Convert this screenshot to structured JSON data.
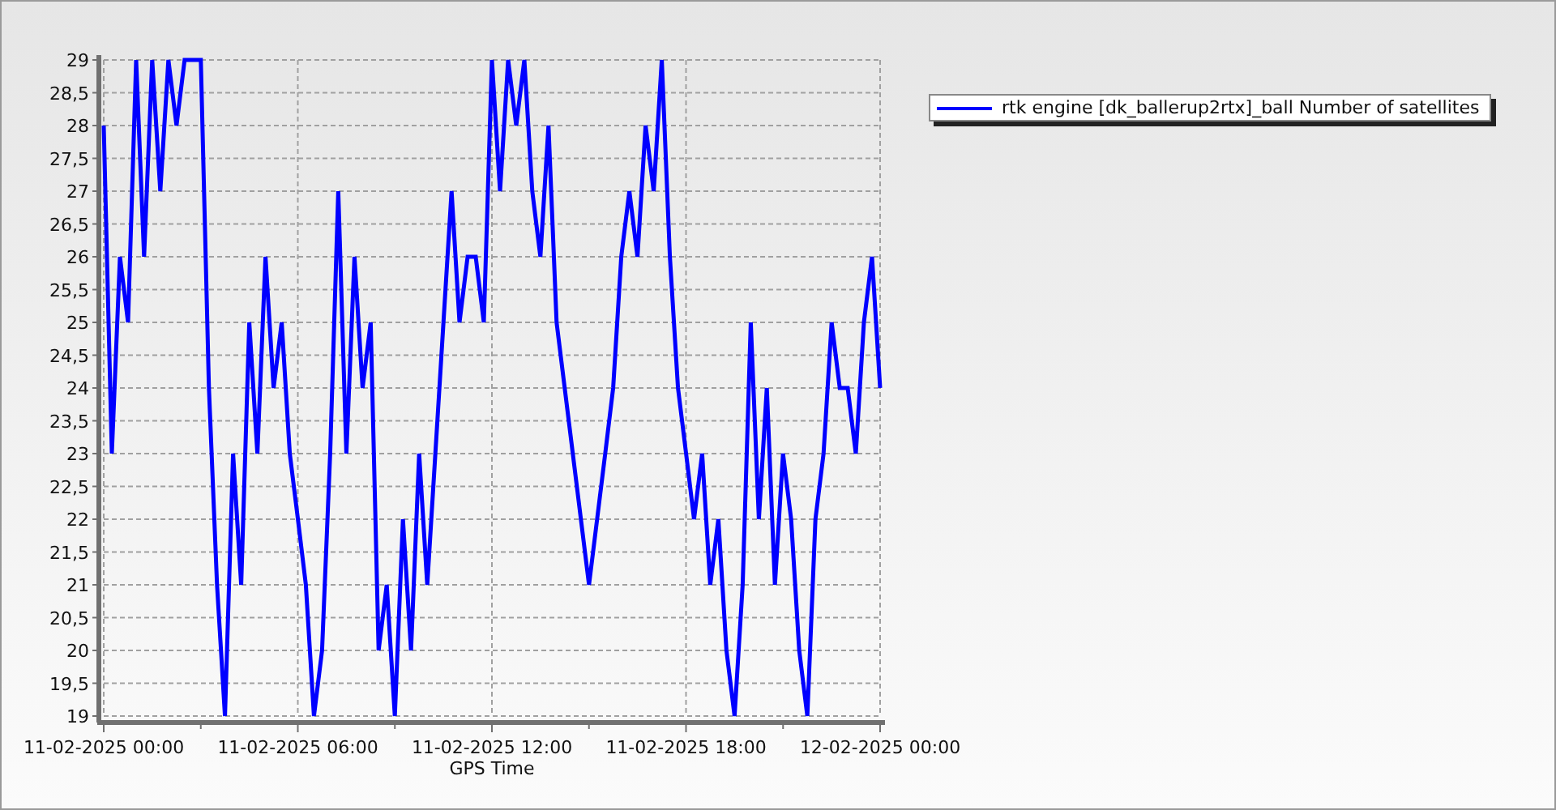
{
  "chart": {
    "chart_data": {
      "type": "line",
      "xlabel": "GPS Time",
      "categories": [
        "11-02-2025 00:00",
        null,
        null,
        null,
        null,
        null,
        null,
        null,
        null,
        null,
        null,
        null,
        null,
        null,
        null,
        null,
        null,
        null,
        null,
        null,
        null,
        null,
        null,
        null,
        "11-02-2025 06:00",
        null,
        null,
        null,
        null,
        null,
        null,
        null,
        null,
        null,
        null,
        null,
        null,
        null,
        null,
        null,
        null,
        null,
        null,
        null,
        null,
        null,
        null,
        null,
        "11-02-2025 12:00",
        null,
        null,
        null,
        null,
        null,
        null,
        null,
        null,
        null,
        null,
        null,
        null,
        null,
        null,
        null,
        null,
        null,
        null,
        null,
        null,
        null,
        null,
        null,
        "11-02-2025 18:00",
        null,
        null,
        null,
        null,
        null,
        null,
        null,
        null,
        null,
        null,
        null,
        null,
        null,
        null,
        null,
        null,
        null,
        null,
        null,
        null,
        null,
        null,
        null,
        "12-02-2025 00:00"
      ],
      "series": [
        {
          "name": "rtk engine [dk_ballerup2rtx]_ball Number of satellites",
          "color": "#0000ff",
          "values": [
            28,
            23,
            26,
            25,
            29,
            26,
            29,
            27,
            29,
            28,
            29,
            29,
            29,
            24,
            21,
            19,
            23,
            21,
            25,
            23,
            26,
            24,
            25,
            23,
            22,
            21,
            19,
            20,
            23,
            27,
            23,
            26,
            24,
            25,
            20,
            21,
            19,
            22,
            20,
            23,
            21,
            23,
            25,
            27,
            25,
            26,
            26,
            25,
            29,
            27,
            29,
            28,
            29,
            27,
            26,
            28,
            25,
            24,
            23,
            22,
            21,
            22,
            23,
            24,
            26,
            27,
            26,
            28,
            27,
            29,
            26,
            24,
            23,
            22,
            23,
            21,
            22,
            20,
            19,
            21,
            25,
            22,
            24,
            21,
            23,
            22,
            20,
            19,
            22,
            23,
            25,
            24,
            24,
            23,
            25,
            26,
            24
          ]
        }
      ],
      "ylim": [
        19,
        29
      ],
      "grid": true,
      "yticks": [
        19,
        {
          "value": 19.5,
          "label": "19,5"
        },
        20,
        {
          "value": 20.5,
          "label": "20,5"
        },
        21,
        {
          "value": 21.5,
          "label": "21,5"
        },
        22,
        {
          "value": 22.5,
          "label": "22,5"
        },
        23,
        {
          "value": 23.5,
          "label": "23,5"
        },
        24,
        {
          "value": 24.5,
          "label": "24,5"
        },
        25,
        {
          "value": 25.5,
          "label": "25,5"
        },
        26,
        {
          "value": 26.5,
          "label": "26,5"
        },
        27,
        {
          "value": 27.5,
          "label": "27,5"
        },
        28,
        {
          "value": 28.5,
          "label": "28,5"
        },
        29
      ]
    }
  }
}
